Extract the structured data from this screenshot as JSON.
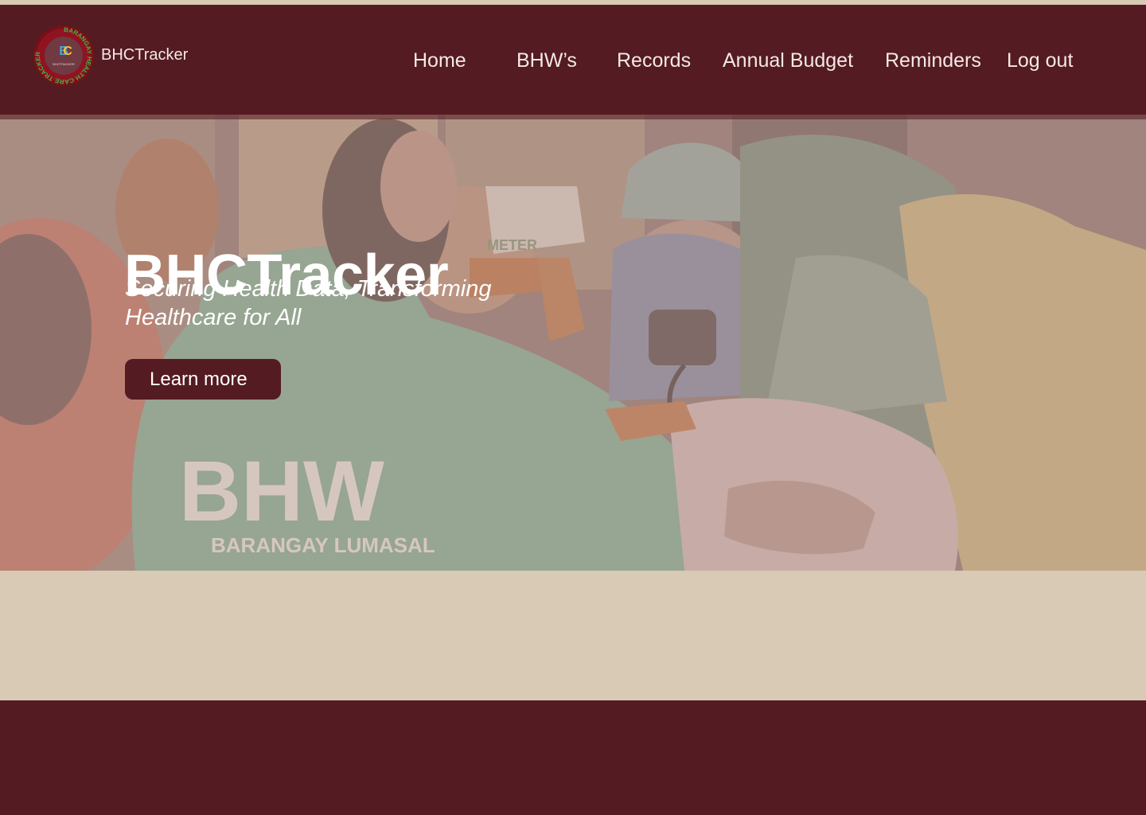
{
  "brand": {
    "name": "BHCTracker",
    "logo_ring_text": "BARANGAY HEALTH CARE TRACKER",
    "logo_inner_text": "BHCTRACKER"
  },
  "nav": {
    "items": [
      {
        "label": "Home"
      },
      {
        "label": "BHW’s"
      },
      {
        "label": "Records"
      },
      {
        "label": "Annual Budget"
      },
      {
        "label": "Reminders"
      },
      {
        "label": "Log out"
      }
    ]
  },
  "hero": {
    "title": "BHCTracker",
    "subtitle": "Securing Health Data, Transforming Healthcare for All",
    "cta_label": "Learn more",
    "photo_shirt_text": "BHW",
    "photo_shirt_subtext": "BARANGAY LUMASAL",
    "photo_box_text": "METER"
  },
  "colors": {
    "primary": "#541b22",
    "background": "#d8cab4",
    "text_light": "#ffffff"
  }
}
